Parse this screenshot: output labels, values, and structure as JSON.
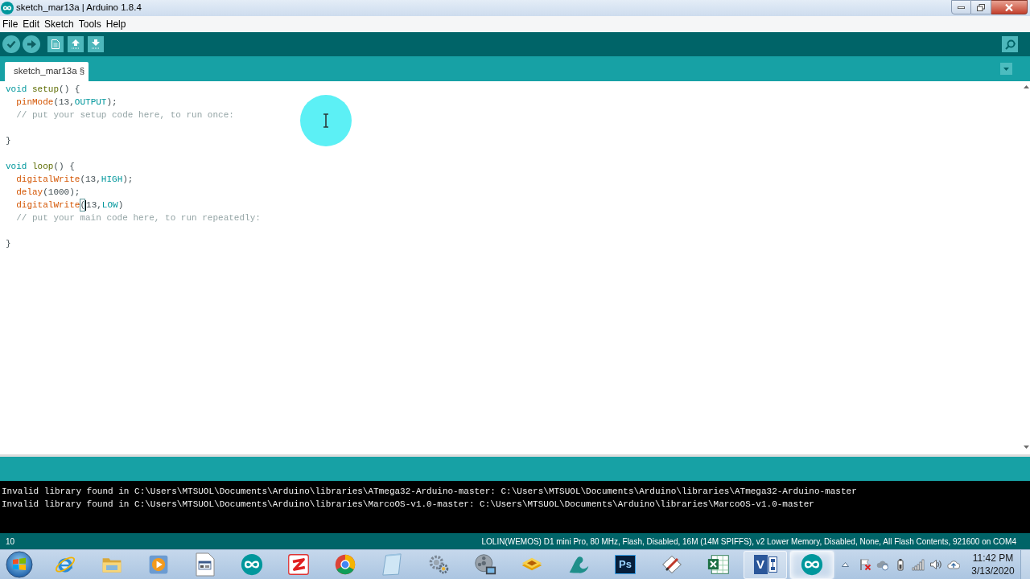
{
  "window": {
    "title": "sketch_mar13a | Arduino 1.8.4"
  },
  "menu": [
    "File",
    "Edit",
    "Sketch",
    "Tools",
    "Help"
  ],
  "tabs": [
    {
      "label": "sketch_mar13a §",
      "selected": true
    }
  ],
  "editor": {
    "lines": [
      {
        "kind": "code",
        "tokens": [
          {
            "text": "void ",
            "kind": "type"
          },
          {
            "text": "setup",
            "kind": "structure"
          },
          {
            "text": "() {",
            "kind": "plain"
          }
        ]
      },
      {
        "kind": "code",
        "tokens": [
          {
            "text": "  pinMode",
            "kind": "function"
          },
          {
            "text": "(13,",
            "kind": "plain"
          },
          {
            "text": "OUTPUT",
            "kind": "constant"
          },
          {
            "text": ");",
            "kind": "plain"
          }
        ]
      },
      {
        "kind": "code",
        "tokens": [
          {
            "text": "  // put your setup code here, to run once:",
            "kind": "comment"
          }
        ]
      },
      {
        "kind": "blank"
      },
      {
        "kind": "code",
        "tokens": [
          {
            "text": "}",
            "kind": "plain"
          }
        ]
      },
      {
        "kind": "blank"
      },
      {
        "kind": "code",
        "tokens": [
          {
            "text": "void ",
            "kind": "type"
          },
          {
            "text": "loop",
            "kind": "structure"
          },
          {
            "text": "() {",
            "kind": "plain"
          }
        ]
      },
      {
        "kind": "code",
        "tokens": [
          {
            "text": "  digitalWrite",
            "kind": "function"
          },
          {
            "text": "(13,",
            "kind": "plain"
          },
          {
            "text": "HIGH",
            "kind": "constant"
          },
          {
            "text": ");",
            "kind": "plain"
          }
        ]
      },
      {
        "kind": "code",
        "tokens": [
          {
            "text": "  delay",
            "kind": "function"
          },
          {
            "text": "(1000);",
            "kind": "plain"
          }
        ]
      },
      {
        "kind": "code",
        "tokens": [
          {
            "text": "  digitalWrite",
            "kind": "function"
          },
          {
            "text": "(",
            "kind": "bracket_match"
          },
          {
            "kind": "caret"
          },
          {
            "text": "13,",
            "kind": "plain"
          },
          {
            "text": "LOW",
            "kind": "constant"
          },
          {
            "text": ")",
            "kind": "plain"
          }
        ]
      },
      {
        "kind": "code",
        "tokens": [
          {
            "text": "  // put your main code here, to run repeatedly:",
            "kind": "comment"
          }
        ]
      },
      {
        "kind": "blank"
      },
      {
        "kind": "code",
        "tokens": [
          {
            "text": "}",
            "kind": "plain"
          }
        ]
      }
    ]
  },
  "console": {
    "lines": [
      "Invalid library found in C:\\Users\\MTSUOL\\Documents\\Arduino\\libraries\\ATmega32-Arduino-master: C:\\Users\\MTSUOL\\Documents\\Arduino\\libraries\\ATmega32-Arduino-master",
      "Invalid library found in C:\\Users\\MTSUOL\\Documents\\Arduino\\libraries\\MarcoOS-v1.0-master: C:\\Users\\MTSUOL\\Documents\\Arduino\\libraries\\MarcoOS-v1.0-master"
    ]
  },
  "status_bar": {
    "line": "10",
    "board": "LOLIN(WEMOS) D1 mini Pro, 80 MHz, Flash, Disabled, 16M (14M SPIFFS), v2 Lower Memory, Disabled, None, All Flash Contents, 921600 on COM4"
  },
  "taskbar": {
    "apps": [
      {
        "kind": "globe",
        "running": false,
        "selected": false
      },
      {
        "kind": "folder",
        "running": false,
        "selected": false
      },
      {
        "kind": "player",
        "running": false,
        "selected": false
      },
      {
        "kind": "document",
        "running": false,
        "selected": false
      },
      {
        "kind": "infinity",
        "running": false,
        "selected": false
      },
      {
        "kind": "zigzag",
        "running": false,
        "selected": false
      },
      {
        "kind": "ring",
        "running": false,
        "selected": false
      },
      {
        "kind": "notepad",
        "running": false,
        "selected": false
      },
      {
        "kind": "gears",
        "running": false,
        "selected": false
      },
      {
        "kind": "reel",
        "running": false,
        "selected": false
      },
      {
        "kind": "chip",
        "running": false,
        "selected": false
      },
      {
        "kind": "seal",
        "running": false,
        "selected": false
      },
      {
        "kind": "letter-tile",
        "label": "Ps",
        "running": false,
        "selected": false
      },
      {
        "kind": "pen",
        "running": false,
        "selected": false
      },
      {
        "kind": "sheet",
        "running": false,
        "selected": false
      },
      {
        "kind": "letter-diagram",
        "label": "V",
        "running": true,
        "selected": false
      },
      {
        "kind": "infinity",
        "running": true,
        "selected": true
      }
    ],
    "clock": {
      "time": "11:42 PM",
      "date": "3/13/2020"
    }
  }
}
